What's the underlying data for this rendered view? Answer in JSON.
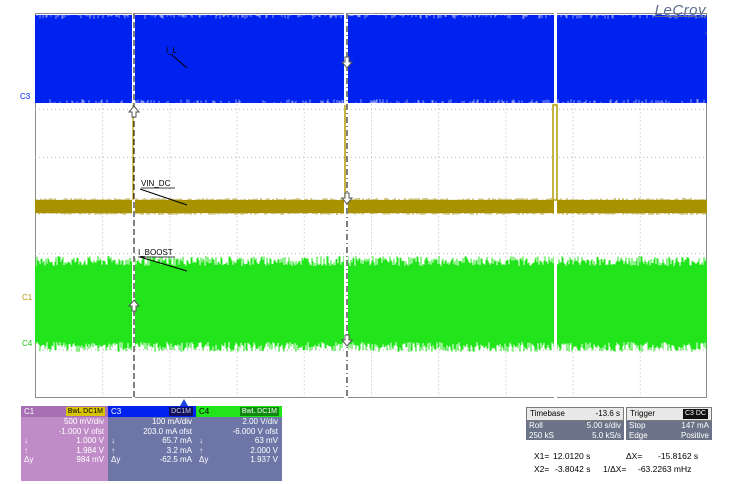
{
  "brand": "LeCroy",
  "waveform_labels": {
    "blue": "I_L",
    "olive": "VIN_DC",
    "green": "I_BOOST"
  },
  "channel_markers": {
    "c3": "C3",
    "c1": "C1",
    "c4": "C4"
  },
  "colors": {
    "c1": "#b29b00",
    "c3": "#0022ee",
    "c4": "#22e41a",
    "c1_panel": "#c08cc8",
    "c3_panel": "#6e76a8",
    "c4_panel": "#6e76a8"
  },
  "channels": [
    {
      "name": "C1",
      "tags": "BwL DC1M",
      "vdiv": "500 mV/div",
      "ofst": "-1.000 V ofst",
      "down_val": "1.000 V",
      "up_val": "1.984 V",
      "delta_val": "984 mV"
    },
    {
      "name": "C3",
      "tags": "DC1M",
      "vdiv": "100 mA/div",
      "ofst": "203.0 mA ofst",
      "down_val": "65.7 mA",
      "up_val": "3.2 mA",
      "delta_val": "-62.5 mA"
    },
    {
      "name": "C4",
      "tags": "BwL DC1M",
      "vdiv": "2.00 V/div",
      "ofst": "-6.000 V ofst",
      "down_val": "63 mV",
      "up_val": "2.000 V",
      "delta_val": "1.937 V"
    }
  ],
  "timebase": {
    "title": "Timebase",
    "offset": "-13.6 s",
    "mode": "Roll",
    "sdiv": "5.00 s/div",
    "samples": "250 kS",
    "rate": "5.0 kS/s"
  },
  "trigger": {
    "title": "Trigger",
    "tags": "C3 DC",
    "mode": "Stop",
    "level": "147 mA",
    "type": "Edge",
    "slope": "Positive"
  },
  "cursors": {
    "x1_label": "X1=",
    "x1": "12.0120 s",
    "dx_label": "ΔX=",
    "dx": "-15.8162 s",
    "x2_label": "X2=",
    "x2": "-3.8042 s",
    "inv_dx_label": "1/ΔX=",
    "inv_dx": "-63.2263 mHz"
  },
  "row_labels": {
    "down": "↓",
    "up": "↑",
    "delta": "Δy"
  }
}
